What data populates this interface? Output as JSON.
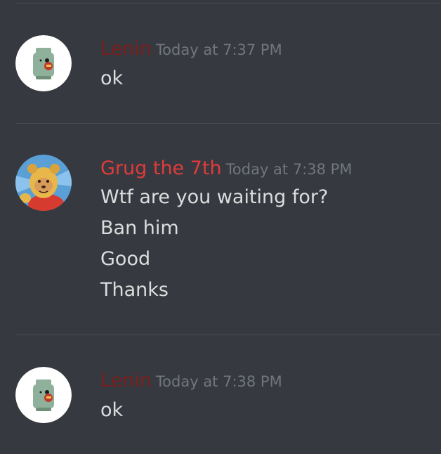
{
  "colors": {
    "background": "#36393f",
    "divider": "#4a4d53",
    "timestamp": "#72767d",
    "message_text": "#dcddde"
  },
  "messages": [
    {
      "author": "Lenin",
      "author_color": "#7a1f1f",
      "timestamp": "Today at 7:37 PM",
      "avatar_icon": "lego-head-avatar",
      "lines": [
        "ok"
      ]
    },
    {
      "author": "Grug the 7th",
      "author_color": "#e03b3b",
      "timestamp": "Today at 7:38 PM",
      "avatar_icon": "cartoon-bear-avatar",
      "lines": [
        "Wtf are you waiting for?",
        "Ban him",
        "Good",
        "Thanks"
      ]
    },
    {
      "author": "Lenin",
      "author_color": "#7a1f1f",
      "timestamp": "Today at 7:38 PM",
      "avatar_icon": "lego-head-avatar",
      "lines": [
        "ok"
      ]
    }
  ]
}
